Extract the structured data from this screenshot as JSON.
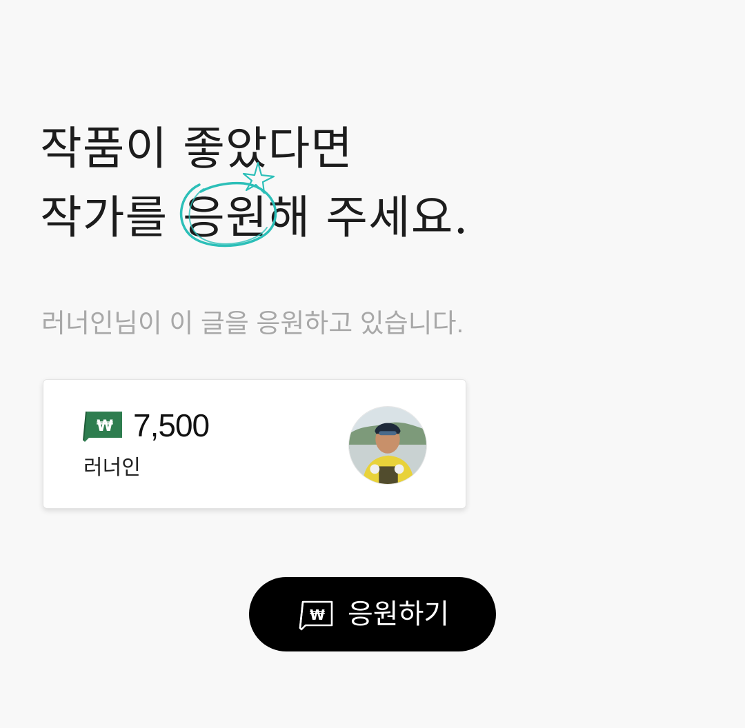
{
  "headline": {
    "line1": "작품이 좋았다면",
    "line2_before": "작가를 ",
    "line2_highlight": "응원",
    "line2_after": "해 주세요."
  },
  "subtitle": "러너인님이 이 글을 응원하고 있습니다.",
  "support_card": {
    "currency_icon": "won-note-icon",
    "amount": "7,500",
    "supporter_name": "러너인",
    "avatar": "supporter-avatar-photo"
  },
  "support_button": {
    "icon": "won-note-icon",
    "label": "응원하기"
  },
  "colors": {
    "background": "#f8f8f8",
    "doodle_accent": "#2cbfb8",
    "badge_green": "#2e7d4f",
    "button_bg": "#000000",
    "subtitle_gray": "#a8a8a8"
  }
}
